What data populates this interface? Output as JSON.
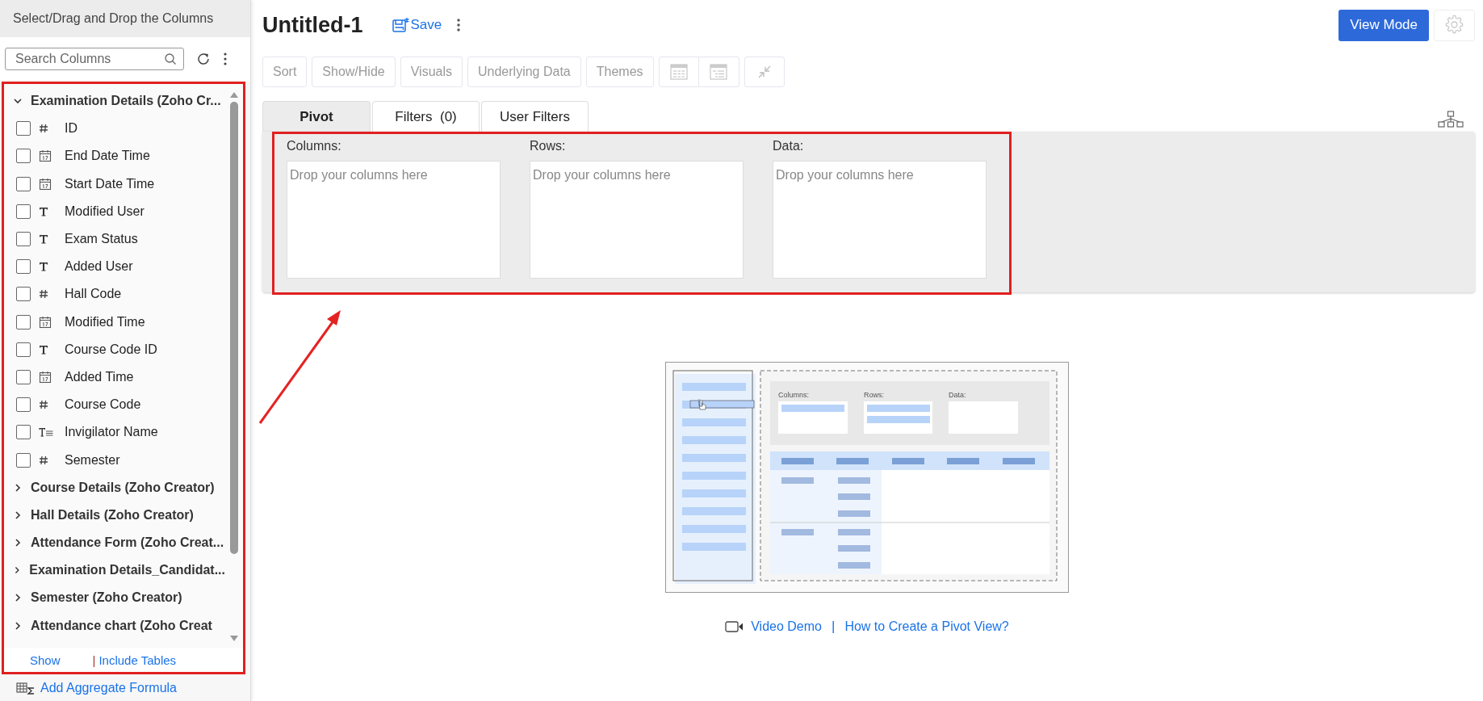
{
  "sidebar": {
    "title": "Select/Drag and Drop the Columns",
    "search": {
      "placeholder": "Search Columns"
    },
    "tables": [
      {
        "name": "Examination Details (Zoho Cr...",
        "expanded": true,
        "columns": [
          {
            "name": "ID",
            "kind": "number",
            "checked": false
          },
          {
            "name": "End Date Time",
            "kind": "date",
            "checked": false
          },
          {
            "name": "Start Date Time",
            "kind": "date",
            "checked": false
          },
          {
            "name": "Modified User",
            "kind": "text",
            "checked": false
          },
          {
            "name": "Exam Status",
            "kind": "text",
            "checked": false
          },
          {
            "name": "Added User",
            "kind": "text",
            "checked": false
          },
          {
            "name": "Hall Code",
            "kind": "number",
            "checked": false
          },
          {
            "name": "Modified Time",
            "kind": "date",
            "checked": false
          },
          {
            "name": "Course Code ID",
            "kind": "text",
            "checked": false
          },
          {
            "name": "Added Time",
            "kind": "date",
            "checked": false
          },
          {
            "name": "Course Code",
            "kind": "number",
            "checked": false
          },
          {
            "name": "Invigilator Name",
            "kind": "multiline",
            "checked": false
          },
          {
            "name": "Semester",
            "kind": "number",
            "checked": false
          }
        ]
      },
      {
        "name": "Course Details (Zoho Creator)",
        "expanded": false
      },
      {
        "name": "Hall Details (Zoho Creator)",
        "expanded": false
      },
      {
        "name": "Attendance Form (Zoho Creat...",
        "expanded": false
      },
      {
        "name": "Examination Details_Candidat...",
        "expanded": false
      },
      {
        "name": "Semester (Zoho Creator)",
        "expanded": false
      },
      {
        "name": "Attendance chart (Zoho Creat",
        "expanded": false
      }
    ],
    "footer": {
      "show_link": "Show",
      "separator": "|",
      "include_link": "Include Tables"
    },
    "aggregate_link": "Add Aggregate Formula"
  },
  "header": {
    "title": "Untitled-1",
    "save": "Save",
    "view_mode": "View Mode"
  },
  "toolbar": [
    "Sort",
    "Show/Hide",
    "Visuals",
    "Underlying Data",
    "Themes"
  ],
  "tabs": [
    {
      "label": "Pivot",
      "selected": true
    },
    {
      "label": "Filters  (0)",
      "selected": false
    },
    {
      "label": "User Filters",
      "selected": false
    }
  ],
  "zones": [
    {
      "label": "Columns:",
      "hint": "Drop your columns here"
    },
    {
      "label": "Rows:",
      "hint": "Drop your columns here"
    },
    {
      "label": "Data:",
      "hint": "Drop your columns here"
    }
  ],
  "help": {
    "illustration_labels": [
      "Columns:",
      "Rows:",
      "Data:"
    ],
    "links": [
      "Video Demo",
      "How to Create a Pivot View?"
    ],
    "separator": "|"
  }
}
